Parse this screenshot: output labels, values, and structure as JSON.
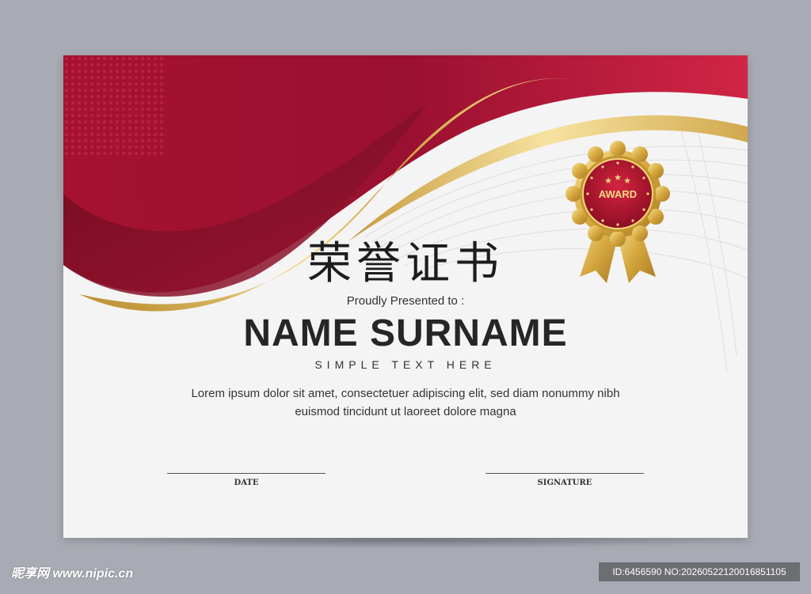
{
  "certificate": {
    "title_cn": "荣誉证书",
    "presented_to": "Proudly Presented to :",
    "recipient_name": "NAME SURNAME",
    "subtitle": "SIMPLE TEXT HERE",
    "body_lines": [
      "Lorem ipsum dolor sit amet, consectetuer adipiscing elit, sed diam nonummy nibh",
      "euismod tincidunt ut laoreet dolore magna"
    ],
    "date_label": "DATE",
    "signature_label": "SIGNATURE",
    "badge": {
      "label": "AWARD",
      "stars": 3
    }
  },
  "watermark": {
    "logo_text": "昵享网 www.nipic.cn",
    "id_text": "ID:6456590 NO:20260522120016851105"
  },
  "colors": {
    "background": "#a8abb3",
    "paper": "#f4f4f4",
    "crimson": "#b5173d",
    "dark_red": "#7c0f25",
    "gold": "#d8b04a",
    "text_dark": "#262626"
  }
}
